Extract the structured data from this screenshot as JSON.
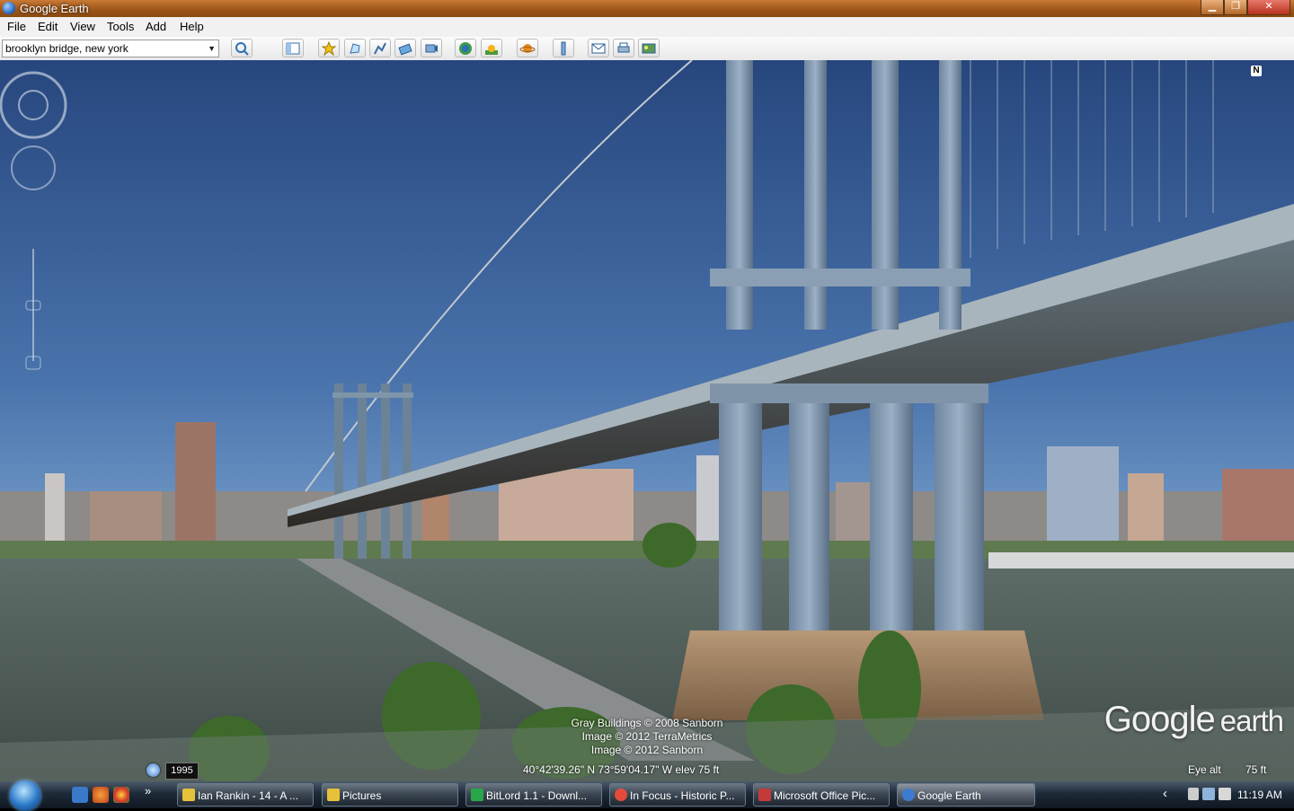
{
  "window": {
    "title": "Google Earth"
  },
  "window_controls": {
    "minimize": "▁",
    "restore": "❐",
    "close": "✕"
  },
  "menu": [
    "File",
    "Edit",
    "View",
    "Tools",
    "Add",
    "Help"
  ],
  "search": {
    "value": "brooklyn bridge, new york",
    "dropdown": "▼"
  },
  "toolbar_icons": [
    "search-icon",
    "sidebar-toggle-icon",
    "placemark-icon",
    "polygon-icon",
    "path-icon",
    "image-overlay-icon",
    "record-tour-icon",
    "historical-imagery-icon",
    "sunlight-icon",
    "sky-planet-icon",
    "ruler-icon",
    "email-icon",
    "print-icon",
    "save-image-icon"
  ],
  "viewport": {
    "credits": [
      "Gray Buildings © 2008 Sanborn",
      "Image © 2012 TerraMetrics",
      "Image © 2012 Sanborn"
    ],
    "watermark": {
      "brand": "Google",
      "product": "earth"
    },
    "compass_label": "N"
  },
  "status": {
    "year": "1995",
    "coordinates": "40°42'39.26\" N  73°59'04.17\" W  elev    75 ft",
    "eye_alt_label": "Eye alt",
    "eye_alt_value": "75 ft"
  },
  "taskbar": {
    "more": "»",
    "tasks": [
      {
        "label": "Ian Rankin - 14 - A ...",
        "icon_color": "#e6c23a"
      },
      {
        "label": "Pictures",
        "icon_color": "#e6c23a"
      },
      {
        "label": "BitLord 1.1 - Downl...",
        "icon_color": "#2aa64a"
      },
      {
        "label": "In Focus - Historic P...",
        "icon_color": "#e44b3b"
      },
      {
        "label": "Microsoft Office Pic...",
        "icon_color": "#c23a3a"
      },
      {
        "label": "Google Earth",
        "icon_color": "#3d7bd1"
      }
    ],
    "tray_arrow": "‹",
    "clock": "11:19 AM"
  }
}
